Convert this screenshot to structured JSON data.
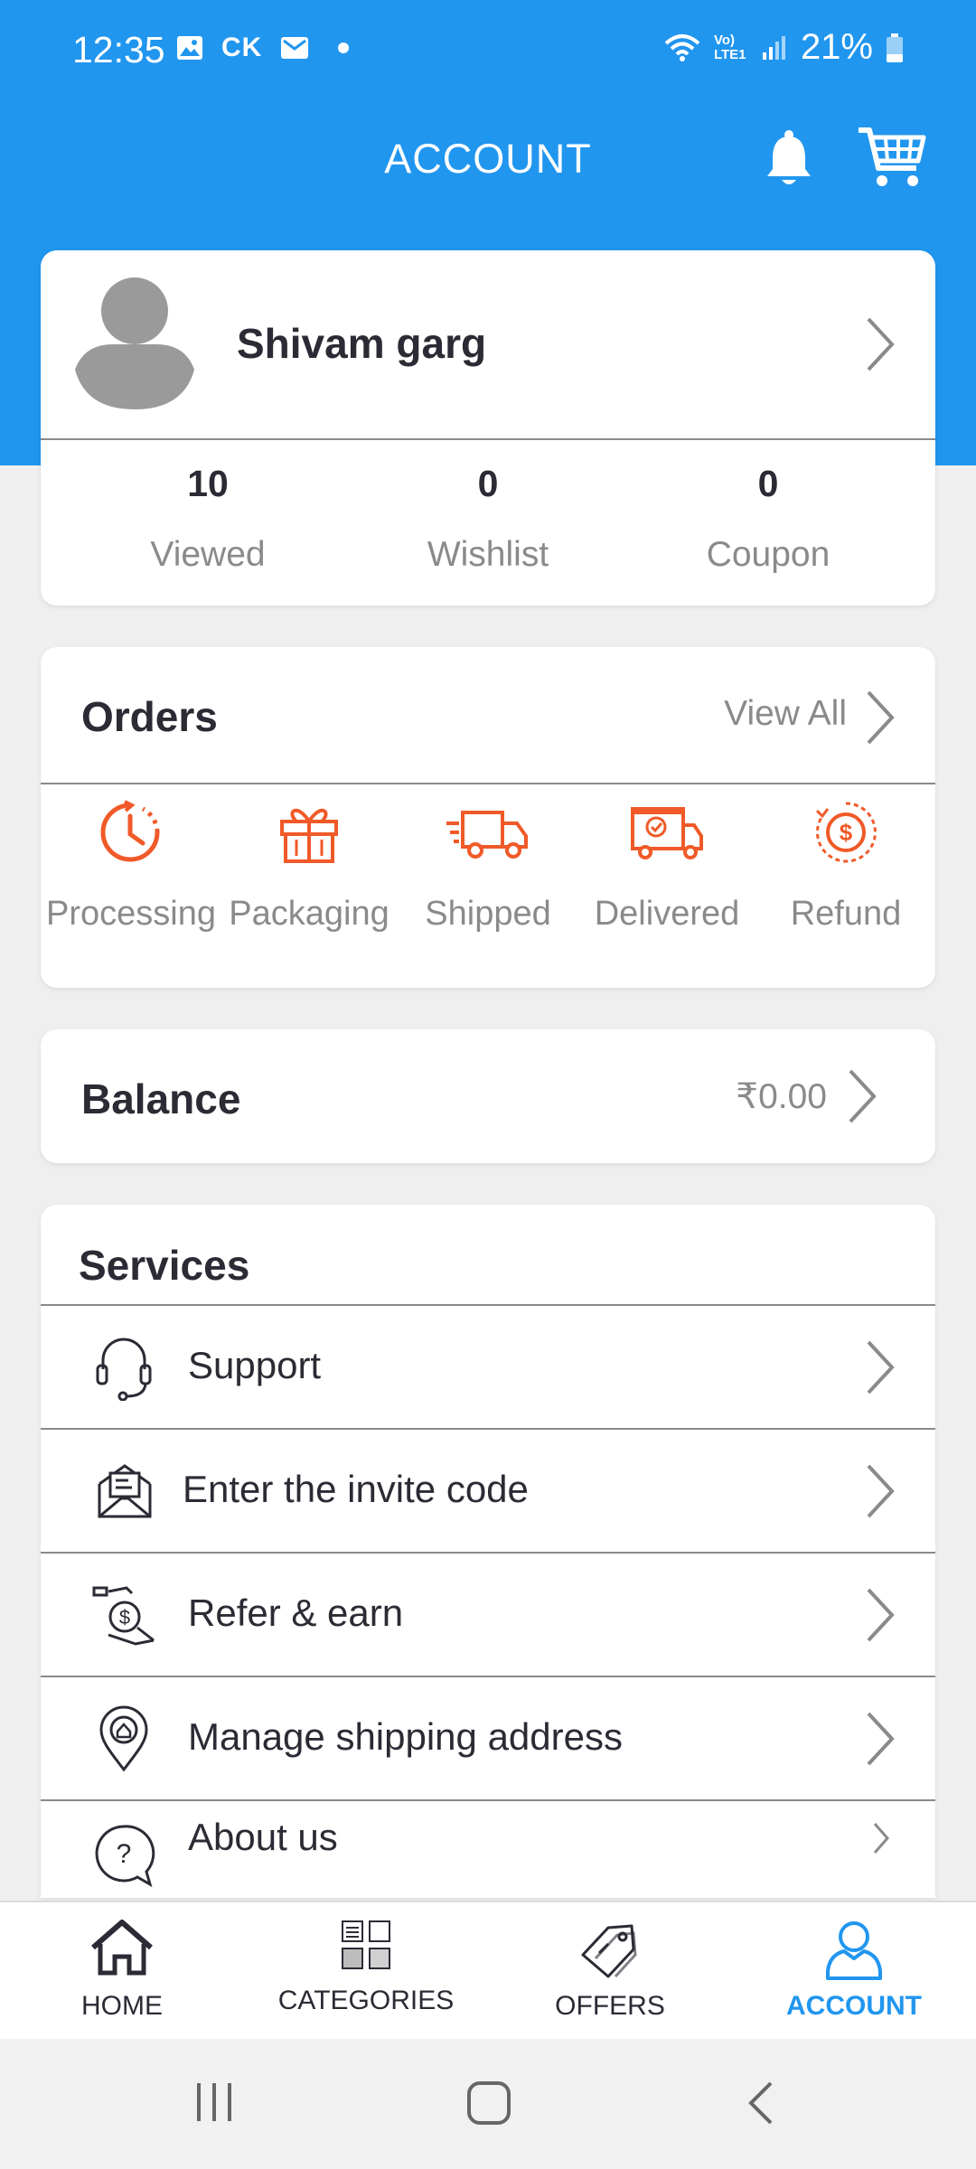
{
  "status": {
    "time": "12:35",
    "carrier_tag": "CK",
    "lte_label": "Vo) LTE1",
    "battery": "21%"
  },
  "header": {
    "title": "ACCOUNT"
  },
  "profile": {
    "name": "Shivam garg",
    "stats": [
      {
        "value": "10",
        "label": "Viewed"
      },
      {
        "value": "0",
        "label": "Wishlist"
      },
      {
        "value": "0",
        "label": "Coupon"
      }
    ]
  },
  "orders": {
    "title": "Orders",
    "view_all": "View All",
    "items": [
      {
        "label": "Processing",
        "icon": "clock-icon"
      },
      {
        "label": "Packaging",
        "icon": "gift-box-icon"
      },
      {
        "label": "Shipped",
        "icon": "truck-icon"
      },
      {
        "label": "Delivered",
        "icon": "delivered-truck-icon"
      },
      {
        "label": "Refund",
        "icon": "refund-coin-icon"
      }
    ]
  },
  "balance": {
    "title": "Balance",
    "value": "₹0.00"
  },
  "services": {
    "title": "Services",
    "items": [
      {
        "label": "Support",
        "icon": "headset-icon"
      },
      {
        "label": "Enter the invite code",
        "icon": "envelope-icon"
      },
      {
        "label": "Refer & earn",
        "icon": "refer-money-icon"
      },
      {
        "label": "Manage shipping address",
        "icon": "location-pin-icon"
      },
      {
        "label": "About us",
        "icon": "question-bubble-icon"
      }
    ]
  },
  "bottom_nav": [
    {
      "label": "HOME",
      "icon": "home-icon"
    },
    {
      "label": "CATEGORIES",
      "icon": "categories-icon"
    },
    {
      "label": "OFFERS",
      "icon": "tag-icon"
    },
    {
      "label": "ACCOUNT",
      "icon": "user-icon",
      "active": true
    }
  ],
  "colors": {
    "primary": "#2196ef",
    "order_icon": "#f05a28",
    "muted_text": "#8a8a8a"
  }
}
